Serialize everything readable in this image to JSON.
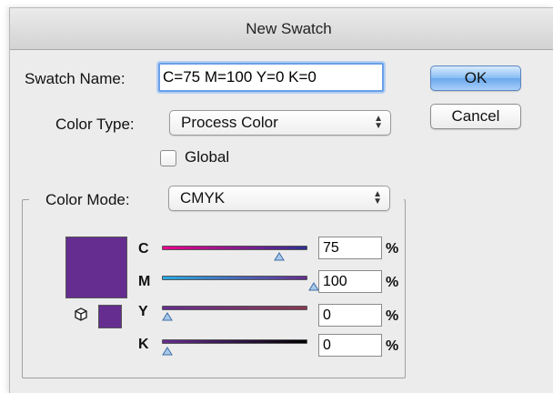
{
  "window": {
    "title": "New Swatch"
  },
  "swatch_name": {
    "label": "Swatch Name:",
    "value": "C=75 M=100 Y=0 K=0"
  },
  "buttons": {
    "ok": "OK",
    "cancel": "Cancel"
  },
  "color_type": {
    "label": "Color Type:",
    "value": "Process Color"
  },
  "global": {
    "label": "Global",
    "checked": false
  },
  "color_mode": {
    "label": "Color Mode:",
    "value": "CMYK"
  },
  "swatch_color": "#662d91",
  "channels": [
    {
      "label": "C",
      "value": "75",
      "unit": "%"
    },
    {
      "label": "M",
      "value": "100",
      "unit": "%"
    },
    {
      "label": "Y",
      "value": "0",
      "unit": "%"
    },
    {
      "label": "K",
      "value": "0",
      "unit": "%"
    }
  ],
  "icons": {
    "out_of_gamut": "cube-icon",
    "select_arrows": "updown-arrows-icon",
    "slider_thumb": "triangle-thumb-icon"
  }
}
